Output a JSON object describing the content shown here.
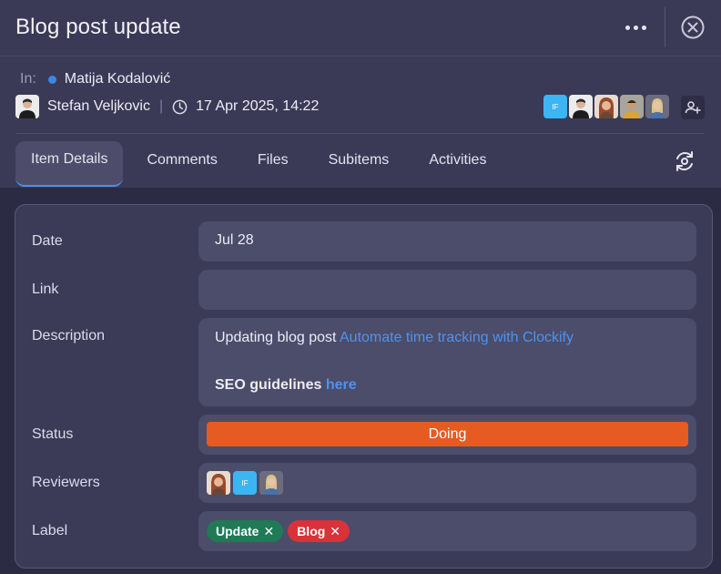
{
  "header": {
    "title": "Blog post update",
    "more_icon": "more-horizontal-icon",
    "close_icon": "close-circle-icon"
  },
  "meta": {
    "in_label": "In:",
    "in_color": "#3b86e6",
    "in_name": "Matija Kodalović",
    "author": "Stefan Veljkovic",
    "separator": "|",
    "timestamp": "17 Apr 2025, 14:22",
    "followers_badge": "IF"
  },
  "tabs": [
    {
      "label": "Item Details",
      "active": true
    },
    {
      "label": "Comments"
    },
    {
      "label": "Files"
    },
    {
      "label": "Subitems"
    },
    {
      "label": "Activities"
    }
  ],
  "fields": {
    "date": {
      "label": "Date",
      "value": "Jul 28"
    },
    "link": {
      "label": "Link",
      "value": ""
    },
    "description": {
      "label": "Description",
      "text": "Updating blog post ",
      "link_text": "Automate time tracking with Clockify",
      "guidelines": "SEO guidelines ",
      "guidelines_link": "here"
    },
    "status": {
      "label": "Status",
      "value": "Doing",
      "color": "#e55b21"
    },
    "reviewers": {
      "label": "Reviewers",
      "badge": "IF"
    },
    "label": {
      "label": "Label",
      "chips": [
        {
          "text": "Update",
          "color": "#1f7a55"
        },
        {
          "text": "Blog",
          "color": "#d8323b"
        }
      ],
      "remove_glyph": "✕"
    }
  }
}
